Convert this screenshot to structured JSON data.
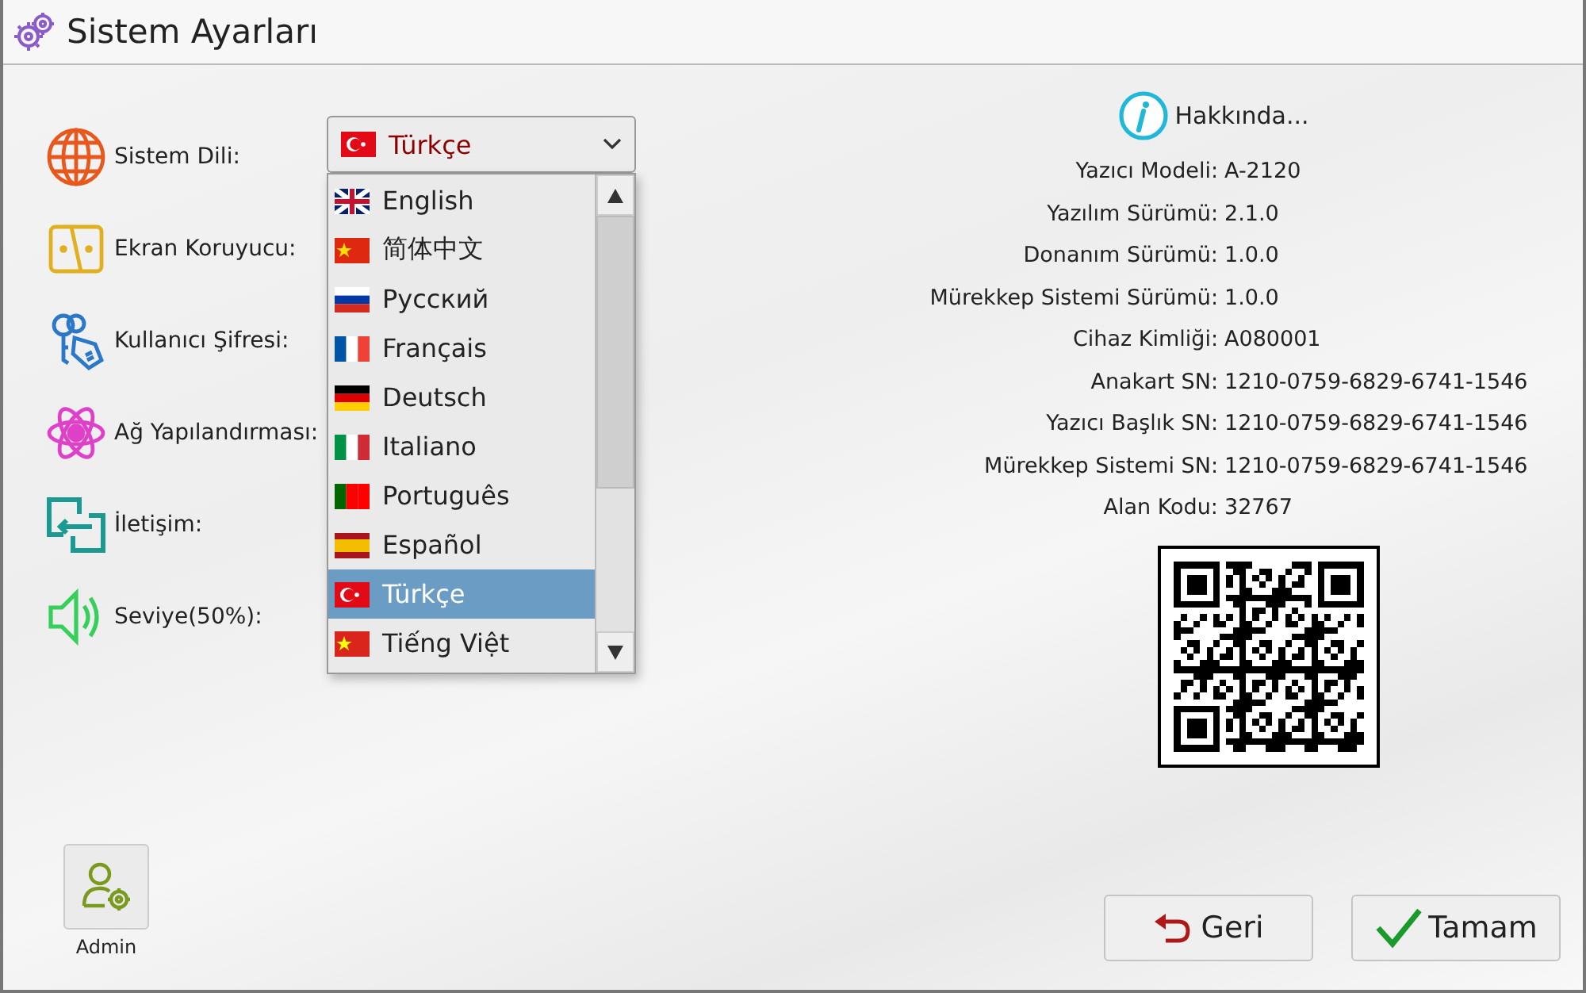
{
  "window": {
    "title": "Sistem Ayarları"
  },
  "settings": [
    {
      "kind": "globe",
      "label": "Sistem Dili:"
    },
    {
      "kind": "screensaver",
      "label": "Ekran Koruyucu:"
    },
    {
      "kind": "password",
      "label": "Kullanıcı Şifresi:"
    },
    {
      "kind": "network",
      "label": "Ağ Yapılandırması:"
    },
    {
      "kind": "communication",
      "label": "İletişim:"
    },
    {
      "kind": "volume",
      "label": "Seviye(50%):"
    }
  ],
  "language_select": {
    "value": "Türkçe",
    "kind": "turkey",
    "expanded": true,
    "options": [
      {
        "label": "English",
        "selected": false,
        "kind": "uk"
      },
      {
        "label": "简体中文",
        "selected": false,
        "kind": "china"
      },
      {
        "label": "Русский",
        "selected": false,
        "kind": "russia"
      },
      {
        "label": "Français",
        "selected": false,
        "kind": "france"
      },
      {
        "label": "Deutsch",
        "selected": false,
        "kind": "germany"
      },
      {
        "label": "Italiano",
        "selected": false,
        "kind": "italy"
      },
      {
        "label": "Português",
        "selected": false,
        "kind": "portugal"
      },
      {
        "label": "Español",
        "selected": false,
        "kind": "spain"
      },
      {
        "label": "Türkçe",
        "selected": true,
        "kind": "turkey"
      },
      {
        "label": "Tiếng Việt",
        "selected": false,
        "kind": "vietnam"
      }
    ]
  },
  "about": {
    "title": "Hakkında...",
    "rows": [
      {
        "label": "Yazıcı Modeli:",
        "value": "A-2120"
      },
      {
        "label": "Yazılım Sürümü:",
        "value": "2.1.0"
      },
      {
        "label": "Donanım Sürümü:",
        "value": "1.0.0"
      },
      {
        "label": "Mürekkep Sistemi Sürümü:",
        "value": "1.0.0"
      },
      {
        "label": "Cihaz Kimliği:",
        "value": "A080001"
      },
      {
        "label": "Anakart SN:",
        "value": "1210-0759-6829-6741-1546"
      },
      {
        "label": "Yazıcı Başlık SN:",
        "value": "1210-0759-6829-6741-1546"
      },
      {
        "label": "Mürekkep Sistemi SN:",
        "value": "1210-0759-6829-6741-1546"
      },
      {
        "label": "Alan Kodu:",
        "value": "32767"
      }
    ]
  },
  "admin": {
    "label": "Admin"
  },
  "buttons": [
    {
      "kind": "back",
      "label": "Geri"
    },
    {
      "kind": "ok",
      "label": "Tamam"
    }
  ]
}
